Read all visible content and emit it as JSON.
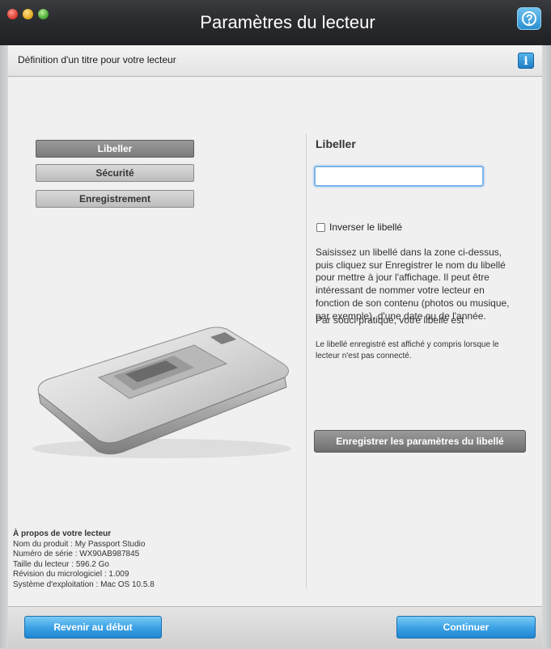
{
  "window": {
    "title": "Paramètres du lecteur",
    "subtitle": "Définition d'un titre pour votre lecteur",
    "info_label": "i"
  },
  "nav": {
    "items": [
      {
        "label": "Libeller",
        "active": true
      },
      {
        "label": "Sécurité",
        "active": false
      },
      {
        "label": "Enregistrement",
        "active": false
      }
    ]
  },
  "about": {
    "heading": "À propos de votre lecteur",
    "product": "Nom du produit : My Passport Studio",
    "serial": "Numéro de série : WX90AB987845",
    "size": "Taille du lecteur : 596.2 Go",
    "firmware": "Révision du micrologiciel : 1.009",
    "os": "Système d'exploitation : Mac OS 10.5.8"
  },
  "label_panel": {
    "title": "Libeller",
    "input_value": "",
    "checkbox_label": "Inverser le libellé",
    "description": "Saisissez un libellé dans la zone ci-dessus, puis cliquez sur Enregistrer le nom du libellé pour mettre à jour l'affichage. Il peut être intéressant de nommer votre lecteur en fonction de son contenu (photos ou musique, par exemple), d'une date ou de l'année.",
    "description2": "Par souci pratique, votre libellé est",
    "description3": "Le libellé enregistré est affiché y compris lorsque le lecteur n'est pas connecté.",
    "save_button": "Enregistrer les paramètres du libellé"
  },
  "footer": {
    "back_button": "Revenir au début",
    "continue_button": "Continuer"
  },
  "colors": {
    "titlebar": "#2b2c2f",
    "accent_blue": "#3ea3e6",
    "panel_bg": "#f0f0f0"
  }
}
